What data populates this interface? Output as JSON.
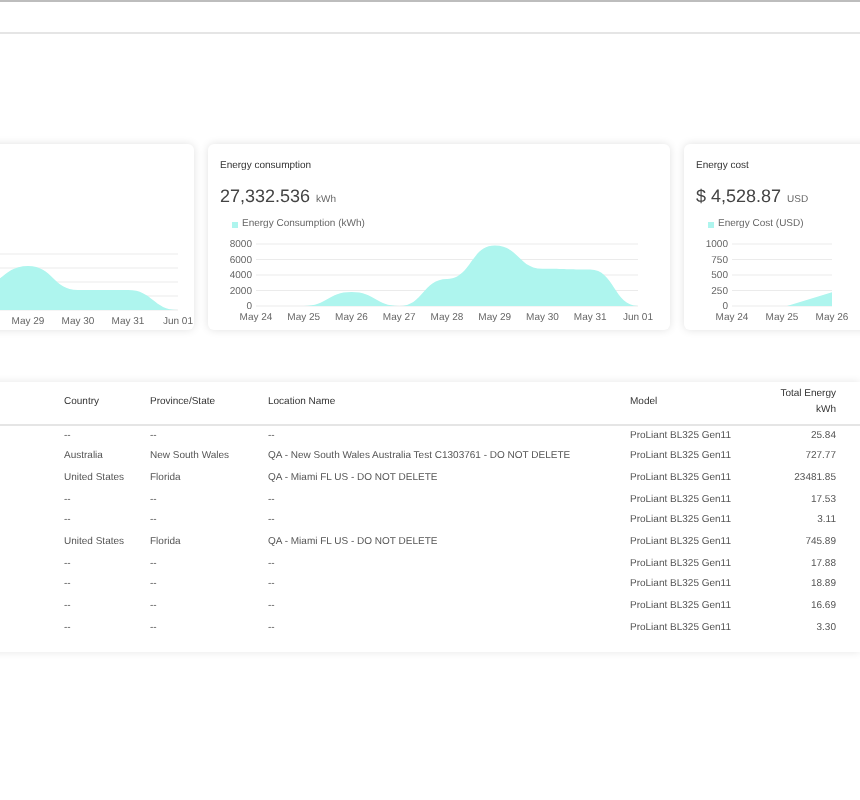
{
  "cards": [
    {
      "kind": "picture",
      "x_labels": [
        "May 29",
        "May 30",
        "May 31",
        "Jun 01"
      ]
    },
    {
      "kind": "chart",
      "title": "Energy consumption",
      "value": "27,332.536",
      "unit": "kWh",
      "chart_data": {
        "type": "area",
        "categories": [
          "May 24",
          "May 25",
          "May 26",
          "May 27",
          "May 28",
          "May 29",
          "May 30",
          "May 31",
          "Jun 01"
        ],
        "series": [
          {
            "name": "Energy Consumption (kWh)",
            "color": "#aef5ee",
            "values": [
              0,
              0,
              1800,
              0,
              3500,
              7800,
              4800,
              4700,
              0
            ]
          }
        ],
        "grid": true,
        "ylim": [
          0,
          8000
        ],
        "yticks": [
          0,
          2000,
          4000,
          6000,
          8000
        ]
      }
    },
    {
      "kind": "chart_picture",
      "title": "Energy cost",
      "value": "$ 4,528.87",
      "unit": "USD",
      "legend": "Energy Cost (USD)",
      "color": "#aef5ee",
      "y_labels": [
        "1000",
        "750",
        "500",
        "250",
        "0"
      ],
      "x_labels": [
        "May 24",
        "May 25",
        "May 26"
      ]
    }
  ],
  "table": {
    "columns": [
      "Country",
      "Province/State",
      "Location Name",
      "Model",
      "Total Energy\nkWh"
    ],
    "rows": [
      [
        "--",
        "--",
        "--",
        "ProLiant BL325 Gen11",
        "25.84"
      ],
      [
        "Australia",
        "New South Wales",
        "QA - New South Wales Australia Test C1303761 - DO NOT DELETE",
        "ProLiant BL325 Gen11",
        "727.77"
      ],
      [
        "United States",
        "Florida",
        "QA - Miami FL US - DO NOT DELETE",
        "ProLiant BL325 Gen11",
        "23481.85"
      ],
      [
        "--",
        "--",
        "--",
        "ProLiant BL325 Gen11",
        "17.53"
      ],
      [
        "--",
        "--",
        "--",
        "ProLiant BL325 Gen11",
        "3.11"
      ],
      [
        "United States",
        "Florida",
        "QA - Miami FL US - DO NOT DELETE",
        "ProLiant BL325 Gen11",
        "745.89"
      ],
      [
        "--",
        "--",
        "--",
        "ProLiant BL325 Gen11",
        "17.88"
      ],
      [
        "--",
        "--",
        "--",
        "ProLiant BL325 Gen11",
        "18.89"
      ],
      [
        "--",
        "--",
        "--",
        "ProLiant BL325 Gen11",
        "16.69"
      ],
      [
        "--",
        "--",
        "--",
        "ProLiant BL325 Gen11",
        "3.30"
      ]
    ]
  }
}
